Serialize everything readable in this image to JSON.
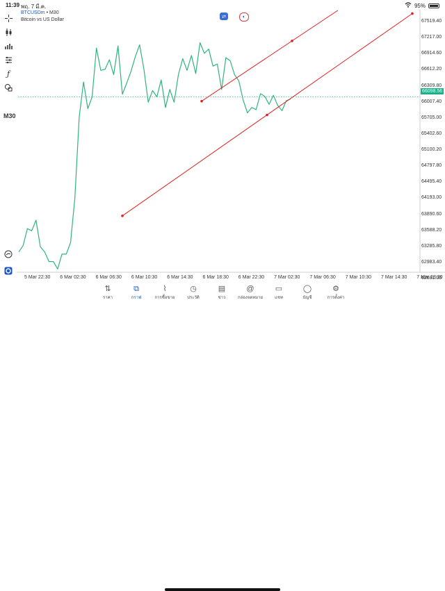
{
  "status": {
    "time": "11:39",
    "date": "พฤ. 7 มี.ค.",
    "battery_text": "95%"
  },
  "symbol": {
    "name": "BTCUSDm",
    "timeframe": "M30",
    "description": "Bitcoin vs US Dollar"
  },
  "toolbar": {
    "timeframe_label": "M30"
  },
  "price_axis": {
    "labels": [
      "67519.40",
      "67217.00",
      "66914.60",
      "66612.20",
      "66309.80",
      "66007.40",
      "65705.00",
      "65402.60",
      "65100.20",
      "64797.80",
      "64495.40",
      "64193.00",
      "63890.60",
      "63588.20",
      "63285.80",
      "62983.40",
      "62681.00"
    ],
    "current_price": "66098.56"
  },
  "time_axis": {
    "labels": [
      "5 Mar 22:30",
      "6 Mar 02:30",
      "6 Mar 06:30",
      "6 Mar 10:30",
      "6 Mar 14:30",
      "6 Mar 18:30",
      "6 Mar 22:30",
      "7 Mar 02:30",
      "7 Mar 06:30",
      "7 Mar 10:30",
      "7 Mar 14:30",
      "7 Mar 18:30"
    ]
  },
  "chart_data": {
    "type": "line",
    "ylim": [
      62681.0,
      67519.4
    ],
    "price_series": [
      63180,
      63300,
      63620,
      63580,
      63780,
      63280,
      63180,
      63000,
      63000,
      62860,
      63140,
      63140,
      63360,
      64200,
      65720,
      66380,
      65880,
      66100,
      67020,
      66600,
      66620,
      66800,
      66520,
      67060,
      66150,
      66360,
      66580,
      66860,
      67080,
      66620,
      66000,
      66220,
      66100,
      66420,
      65900,
      66240,
      66000,
      66520,
      66820,
      66600,
      66880,
      66540,
      67120,
      66920,
      67000,
      66680,
      66720,
      66240,
      66840,
      66780,
      66520,
      66400,
      66040,
      65800,
      65900,
      65860,
      66160,
      66110,
      65960,
      66130,
      65940,
      65840,
      66030,
      66060
    ],
    "trend_channel": {
      "color": "#e02020",
      "lower_line": {
        "start_price": 63860,
        "end_price": 67670
      },
      "upper_line": {
        "start_price": 66020,
        "end_price": 67730
      }
    }
  },
  "nav": {
    "items": [
      {
        "label": "ราคา",
        "icon": "quotes-icon",
        "active": false
      },
      {
        "label": "กราฟ",
        "icon": "chart-icon",
        "active": true
      },
      {
        "label": "การซื้อขาย",
        "icon": "trade-icon",
        "active": false
      },
      {
        "label": "ประวัติ",
        "icon": "history-icon",
        "active": false
      },
      {
        "label": "ข่าว",
        "icon": "news-icon",
        "active": false
      },
      {
        "label": "กล่องจดหมาย",
        "icon": "mailbox-icon",
        "active": false
      },
      {
        "label": "แชท",
        "icon": "chat-icon",
        "active": false
      },
      {
        "label": "บัญชี",
        "icon": "account-icon",
        "active": false
      },
      {
        "label": "การตั้งค่า",
        "icon": "settings-icon",
        "active": false
      }
    ]
  },
  "colors": {
    "series": "#2fb37f",
    "trendline": "#e02020",
    "current_price_bg": "#1fae8b",
    "accent": "#1a56c6"
  }
}
